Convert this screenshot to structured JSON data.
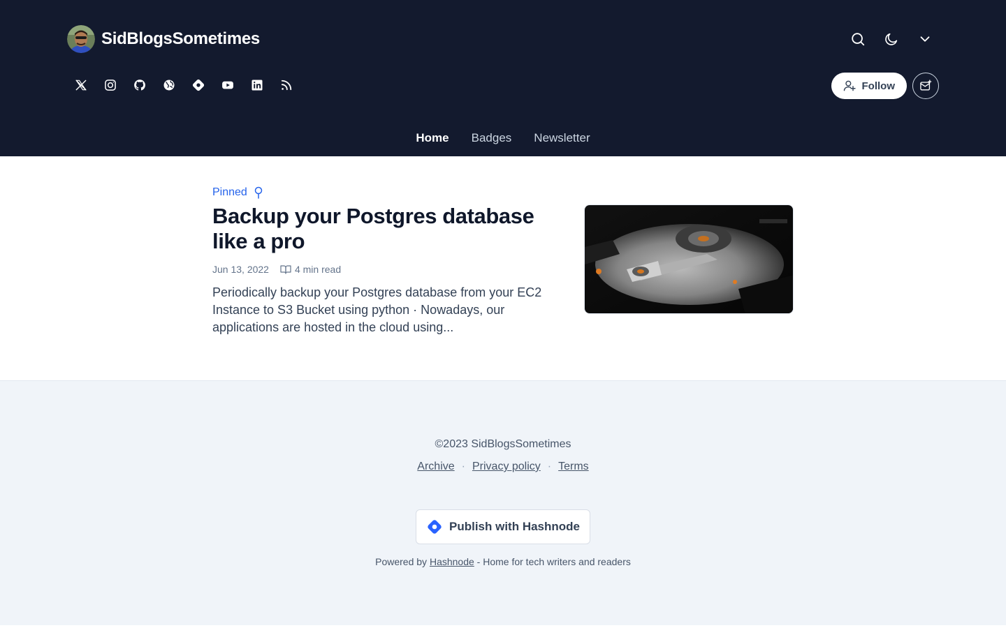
{
  "header": {
    "blog_name": "SidBlogsSometimes",
    "avatar_icon": "author-avatar",
    "actions": [
      {
        "name": "search",
        "icon": "search-icon"
      },
      {
        "name": "theme-toggle",
        "icon": "moon-icon"
      },
      {
        "name": "more",
        "icon": "chevron-down-icon"
      }
    ],
    "socials": [
      "x-icon",
      "instagram-icon",
      "github-icon",
      "website-icon",
      "hashnode-icon",
      "youtube-icon",
      "linkedin-icon",
      "rss-icon"
    ],
    "follow_label": "Follow",
    "newsletter_icon": "newsletter-icon",
    "colors": {
      "bg": "#131a2e",
      "text": "#ffffff",
      "muted": "#cbd5e1"
    }
  },
  "nav": {
    "items": [
      {
        "label": "Home",
        "active": true
      },
      {
        "label": "Badges",
        "active": false
      },
      {
        "label": "Newsletter",
        "active": false
      }
    ]
  },
  "post": {
    "pinned_label": "Pinned",
    "title": "Backup your Postgres database like a pro",
    "date": "Jun 13, 2022",
    "read_time": "4 min read",
    "excerpt": "Periodically backup your Postgres database from your EC2 Instance to S3 Bucket using python · Nowadays, our applications are hosted in the cloud using...",
    "cover_image": "hard-drive-photo",
    "accent": "#2563eb"
  },
  "footer": {
    "copyright": "©2023 SidBlogsSometimes",
    "links": [
      "Archive",
      "Privacy policy",
      "Terms"
    ],
    "separator": "·",
    "publish_label": "Publish with Hashnode",
    "powered_prefix": "Powered by",
    "powered_link": "Hashnode",
    "powered_suffix": "- Home for tech writers and readers",
    "bg": "#f0f4f9"
  }
}
